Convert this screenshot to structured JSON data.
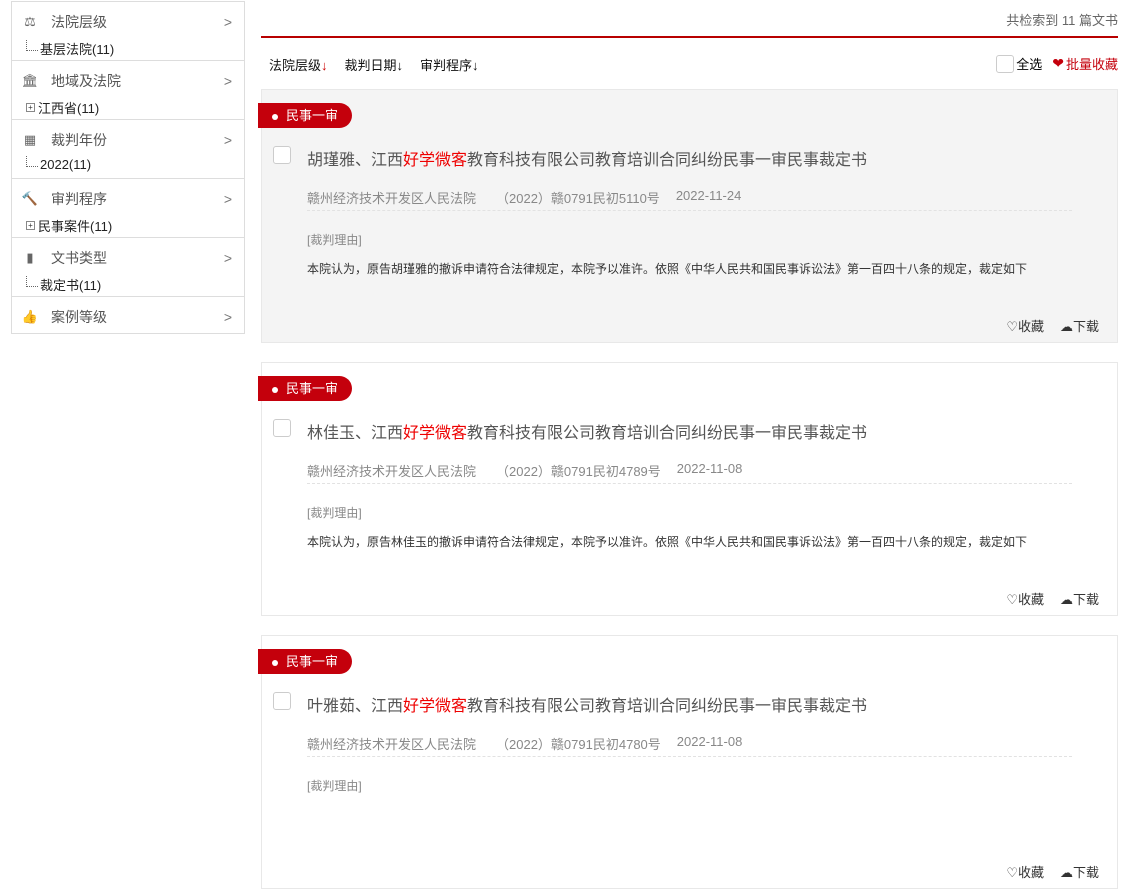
{
  "sidebar": [
    {
      "label": "法院层级",
      "icon": "scale-icon",
      "sub": "基层法院(11)",
      "expand": false
    },
    {
      "label": "地域及法院",
      "icon": "bank-icon",
      "sub": "江西省(11)",
      "expand": true
    },
    {
      "label": "裁判年份",
      "icon": "calendar-icon",
      "sub": "2022(11)",
      "expand": false
    },
    {
      "label": "审判程序",
      "icon": "gavel-icon",
      "sub": "民事案件(11)",
      "expand": true
    },
    {
      "label": "文书类型",
      "icon": "copy-icon",
      "sub": "裁定书(11)",
      "expand": false
    },
    {
      "label": "案例等级",
      "icon": "thumbs-up-icon",
      "sub": null
    }
  ],
  "header": {
    "count": "共检索到 11 篇文书"
  },
  "sort": [
    {
      "label": "法院层级",
      "arrow": "↓",
      "active": true
    },
    {
      "label": "裁判日期",
      "arrow": "↓"
    },
    {
      "label": "审判程序",
      "arrow": "↓"
    }
  ],
  "tools": {
    "select_all": "全选",
    "batch_collect": "批量收藏"
  },
  "accent": "#c4000c",
  "cards": [
    {
      "tag": "民事一审",
      "title_pre": "胡瑾雅、江西",
      "title_hl": "好学微客",
      "title_post": "教育科技有限公司教育培训合同纠纷民事一审民事裁定书",
      "court": "赣州经济技术开发区人民法院",
      "case_no": "（2022）赣0791民初5110号",
      "date": "2022-11-24",
      "reason_label": "[裁判理由]",
      "reason": "本院认为，原告胡瑾雅的撤诉申请符合法律规定，本院予以准许。依照《中华人民共和国民事诉讼法》第一百四十八条的规定，裁定如下",
      "collect": "收藏",
      "download": "下载"
    },
    {
      "tag": "民事一审",
      "title_pre": "林佳玉、江西",
      "title_hl": "好学微客",
      "title_post": "教育科技有限公司教育培训合同纠纷民事一审民事裁定书",
      "court": "赣州经济技术开发区人民法院",
      "case_no": "（2022）赣0791民初4789号",
      "date": "2022-11-08",
      "reason_label": "[裁判理由]",
      "reason": "本院认为，原告林佳玉的撤诉申请符合法律规定，本院予以准许。依照《中华人民共和国民事诉讼法》第一百四十八条的规定，裁定如下",
      "collect": "收藏",
      "download": "下载"
    },
    {
      "tag": "民事一审",
      "title_pre": "叶雅茹、江西",
      "title_hl": "好学微客",
      "title_post": "教育科技有限公司教育培训合同纠纷民事一审民事裁定书",
      "court": "赣州经济技术开发区人民法院",
      "case_no": "（2022）赣0791民初4780号",
      "date": "2022-11-08",
      "reason_label": "[裁判理由]",
      "reason": "",
      "collect": "收藏",
      "download": "下载"
    }
  ]
}
